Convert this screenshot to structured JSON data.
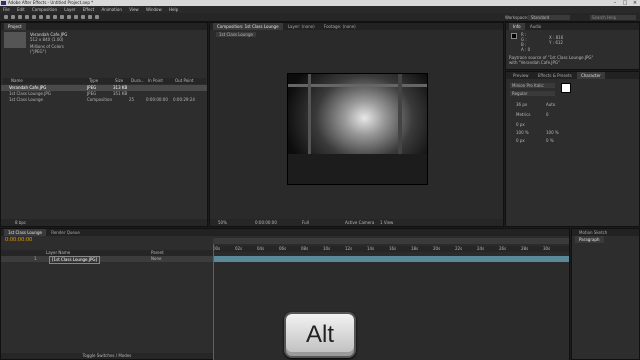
{
  "app": {
    "title": "Adobe After Effects - Untitled Project.aep *",
    "menus": [
      "File",
      "Edit",
      "Composition",
      "Layer",
      "Effect",
      "Animation",
      "View",
      "Window",
      "Help"
    ]
  },
  "toolbar": {
    "workspace_label": "Workspace:",
    "workspace_value": "Standard",
    "search_placeholder": "Search Help"
  },
  "project_panel": {
    "tab": "Project",
    "selected_name": "Verandah Cafe.JPG",
    "selected_info1": "512 x 840 (1.00)",
    "selected_info2": "Millions of Colors",
    "selected_info3": "(\"JPEG\")",
    "columns": [
      "Name",
      "Type",
      "Size",
      "Dura...",
      "In Point",
      "Out Point"
    ],
    "items": [
      {
        "name": "Verandah Cafe.JPG",
        "type": "JPEG",
        "size": "313 KB",
        "duration": "",
        "in": "",
        "out": ""
      },
      {
        "name": "1st Class Lounge.JPG",
        "type": "JPEG",
        "size": "351 KB",
        "duration": "",
        "in": "",
        "out": ""
      },
      {
        "name": "1st Class Lounge",
        "type": "Composition",
        "size": "",
        "duration": "25",
        "in": "0:00:00:00",
        "out": "0:00:29:24"
      }
    ],
    "footer": "8 bpc"
  },
  "composition_panel": {
    "tab": "Composition: 1st Class Lounge",
    "layer_tab": "Layer: (none)",
    "footage_tab": "Footage: (none)",
    "subtab": "1st Class Lounge",
    "zoom": "50%",
    "timecode": "0:00:00:00",
    "resolution": "Full",
    "camera": "Active Camera",
    "views": "1 View"
  },
  "info_panel": {
    "tabs": [
      "Info",
      "Audio"
    ],
    "r": "R :",
    "g": "G :",
    "b": "B :",
    "a": "A : 0",
    "x": "X : 816",
    "y": "Y : 612",
    "desc1": "Raytrace source of \"1st Class Lounge.JPG\"",
    "desc2": "with \"Verandah Cafe.JPG\""
  },
  "character_panel": {
    "tabs": [
      "Preview",
      "Effects & Presets",
      "Character"
    ],
    "font": "Minion Pro Italic",
    "style": "Regular",
    "size": "36 px",
    "leading": "Auto",
    "kerning": "Metrics",
    "tracking": "0",
    "vscale": "100 %",
    "hscale": "100 %",
    "baseline": "0 px",
    "tsume": "0 %",
    "stroke": "0 px"
  },
  "timeline": {
    "tabs": [
      "1st Class Lounge",
      "Render Queue"
    ],
    "timecode": "0:00:00:00",
    "columns": [
      "Layer Name",
      "Parent"
    ],
    "layer_num": "1",
    "layer_name": "[1st Class Lounge.JPG]",
    "parent": "None",
    "ruler": [
      "00s",
      "02s",
      "04s",
      "06s",
      "08s",
      "10s",
      "12s",
      "14s",
      "16s",
      "18s",
      "20s",
      "22s",
      "24s",
      "26s",
      "28s",
      "30s"
    ],
    "footer": "Toggle Switches / Modes"
  },
  "right_bottom": {
    "tabs": [
      "Motion Sketch",
      "Paragraph"
    ]
  },
  "overlay": {
    "key": "Alt"
  }
}
